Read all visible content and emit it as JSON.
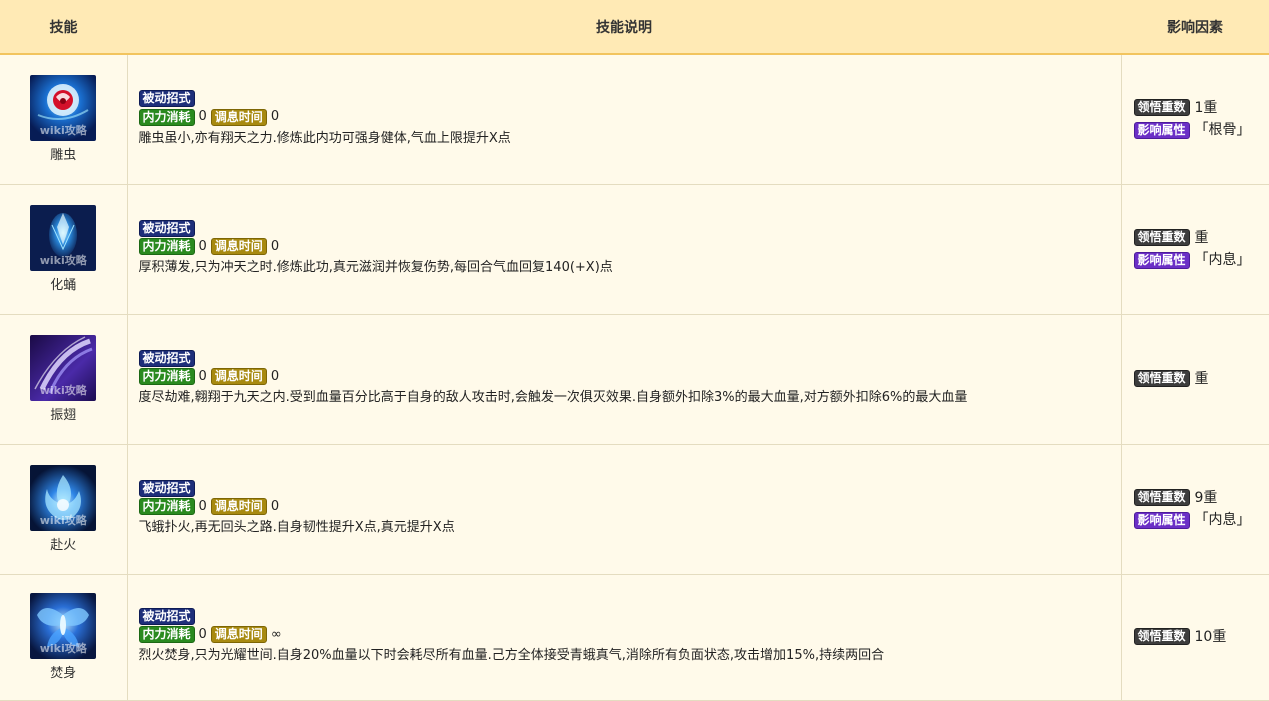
{
  "headers": {
    "skill": "技能",
    "desc": "技能说明",
    "factor": "影响因素"
  },
  "tags": {
    "passive": "被动招式",
    "cost": "内力消耗",
    "time": "调息时间",
    "comprehension": "领悟重数",
    "attribute": "影响属性"
  },
  "watermark": "wiki攻略",
  "rows": [
    {
      "name": "雕虫",
      "cost": "0",
      "time": "0",
      "text": "雕虫虽小,亦有翔天之力.修炼此内功可强身健体,气血上限提升X点",
      "comp": "1重",
      "attr": "「根骨」"
    },
    {
      "name": "化蛹",
      "cost": "0",
      "time": "0",
      "text": "厚积薄发,只为冲天之时.修炼此功,真元滋润并恢复伤势,每回合气血回复140(+X)点",
      "comp": "重",
      "attr": "「内息」"
    },
    {
      "name": "振翅",
      "cost": "0",
      "time": "0",
      "text": "度尽劫难,翱翔于九天之内.受到血量百分比高于自身的敌人攻击时,会触发一次俱灭效果.自身额外扣除3%的最大血量,对方额外扣除6%的最大血量",
      "comp": "重",
      "attr": ""
    },
    {
      "name": "赴火",
      "cost": "0",
      "time": "0",
      "text": "飞蛾扑火,再无回头之路.自身韧性提升X点,真元提升X点",
      "comp": "9重",
      "attr": "「内息」"
    },
    {
      "name": "焚身",
      "cost": "0",
      "time": "∞",
      "text": "烈火焚身,只为光耀世间.自身20%血量以下时会耗尽所有血量.己方全体接受青蛾真气,消除所有负面状态,攻击增加15%,持续两回合",
      "comp": "10重",
      "attr": ""
    }
  ]
}
